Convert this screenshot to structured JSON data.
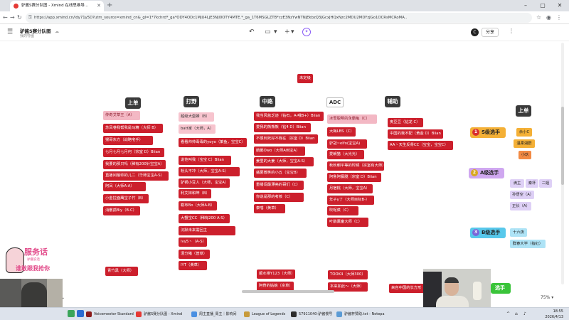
{
  "browser": {
    "tab_title": "驴酱S赛分队图 - Xmind 在线思维导...",
    "new_tab": "+",
    "url": "https://app.xmind.cn/idy71y5D?utm_source=xmind_cn&_gl=1*7kchrd*_ga*ODY4ODc1MjU4LjE3NjI0OTY4MTE.*_ga_1T6MSGLZTB*czE3NzYwNTNjEkbzQ3JGcxJHQxNzc2MDU2MDYzJGo1OCRsMCRoMA.."
  },
  "app": {
    "doc_title": "驴酱S赛分队图",
    "doc_sub": "我的导图",
    "share_label": "分享",
    "avatar_letter": "C",
    "zoom": "75%",
    "add_label": "+"
  },
  "lanes": {
    "top": "上单",
    "jungle": "打野",
    "mid": "中路",
    "adc": "ADC",
    "support": "辅助",
    "top2": "上单",
    "unassigned": "未定级"
  },
  "nodes": {
    "top": [
      "传奇艾草王（A）",
      "苏凤巷我帮我是马精（大师 B）",
      "猴哥东方（战略宅手）",
      "七月七月七月何（宗室 D）Biian",
      "我要的那只吗（稀有200针宝宝A）",
      "直播间最帅的儿二（华师宝宝A-S）",
      "阿凤（大师A-A）",
      "小金拉面鹰宝子竹（B）",
      "消散孤Biy（B-C）"
    ],
    "jungle": [
      "超级大蛋蜂（B）",
      "batt家（大师，A）",
      "看看帅帅毒毒的yoyo（策鱼，宝宝C）",
      "说他叫我（宝宝 C）Biian",
      "粉头不冲（大师，宝宝A-S）",
      "驴锅小豆人（大师，宝宝A）",
      "利艾袜和坤（B）",
      "勒布Bo（大师A-B）",
      "大蟹宝CC（稀有200 A-S）",
      "沉默未来需回主",
      "Ivy5丶（A-S）",
      "混分猪（普草）",
      "IYT（黄草）"
    ],
    "mid": [
      "我当风蓝乏迹（钻石，A-哦B+）Biian",
      "爱我的熊熊熊（钻4 D）Biian",
      "不惧到死好不我在（宗室 D）Biian",
      "鹅鹅Owo（大师A到宝A）",
      "姜里的大姜（大师，宝宝A-S）",
      "盛夏微笑的小五（宝宝B）",
      "重播闯最漂亮的哥们（C）",
      "你说是那的考核（C）",
      "泰唾（黄草）"
    ],
    "adc": [
      "冰雪聪明的永霸龟（C）",
      "大梅LBS（C）",
      "驴冠~elfo(宝宝A)",
      "爱朝猫（大光光）",
      "秋秋朝平等的时候（宗室有大师）",
      "阿鲁阿朦胧（宗室 D）Biian",
      "月宿桃（大师，宝宝A）",
      "年子y了（大师目标B-）",
      "吹呢菜（C）",
      "叶鹃薰童大师（C）"
    ],
    "support": [
      "奥豆豆（钻龙 C）",
      "中国的我不配（黄金 D）Biian",
      "AA丶天生反骨CC（宝宝，宝宝C）"
    ]
  },
  "tiers": {
    "s": {
      "num": "1",
      "label": "S级选手",
      "members": [
        "余小C",
        "温柔湖群",
        "小玖"
      ]
    },
    "a": {
      "num": "2",
      "label": "A级选手",
      "members": [
        "滴主",
        "秦杯",
        "二姐",
        "孙悟空（A）",
        "正长（A）"
      ]
    },
    "b": {
      "num": "3",
      "label": "B级选手",
      "members": [
        "十六夜",
        "群春大学（指紅）"
      ]
    },
    "c_label": "选手"
  },
  "bottom_nodes": {
    "top_lane": "青竹黑（大师）",
    "mid_a": "顺水推Y123（大师）",
    "mid_b": "阿骨的姑娘（宗草）",
    "adc_a": "TOOK4（大师300）",
    "adc_b": "本来如此～（大师）",
    "support_a": "来自中国的长方形"
  },
  "taskbar": {
    "apps": [
      "Voicemeeter Standard",
      "驴酱S赛分队图 - Xmind",
      "周主直播_周主｜影响间",
      "League of Legends",
      "57911040-驴酱慢号",
      "驴酱杯赞助.txt - Notepa"
    ],
    "time": "18:55",
    "date": "2026/4/13"
  },
  "overlay": {
    "sticker_line1": "服务话",
    "sticker_sub": "驴酱说话",
    "sticker_line2": "谁敢跟我抢你"
  },
  "colors": {
    "node_red": "#cc1f2c",
    "node_pink": "#f3b8c4",
    "lane_dark": "#3a3a3a",
    "tier_s": "#f4b036",
    "tier_a": "#cfa7f0",
    "tier_b": "#58c8eb"
  }
}
